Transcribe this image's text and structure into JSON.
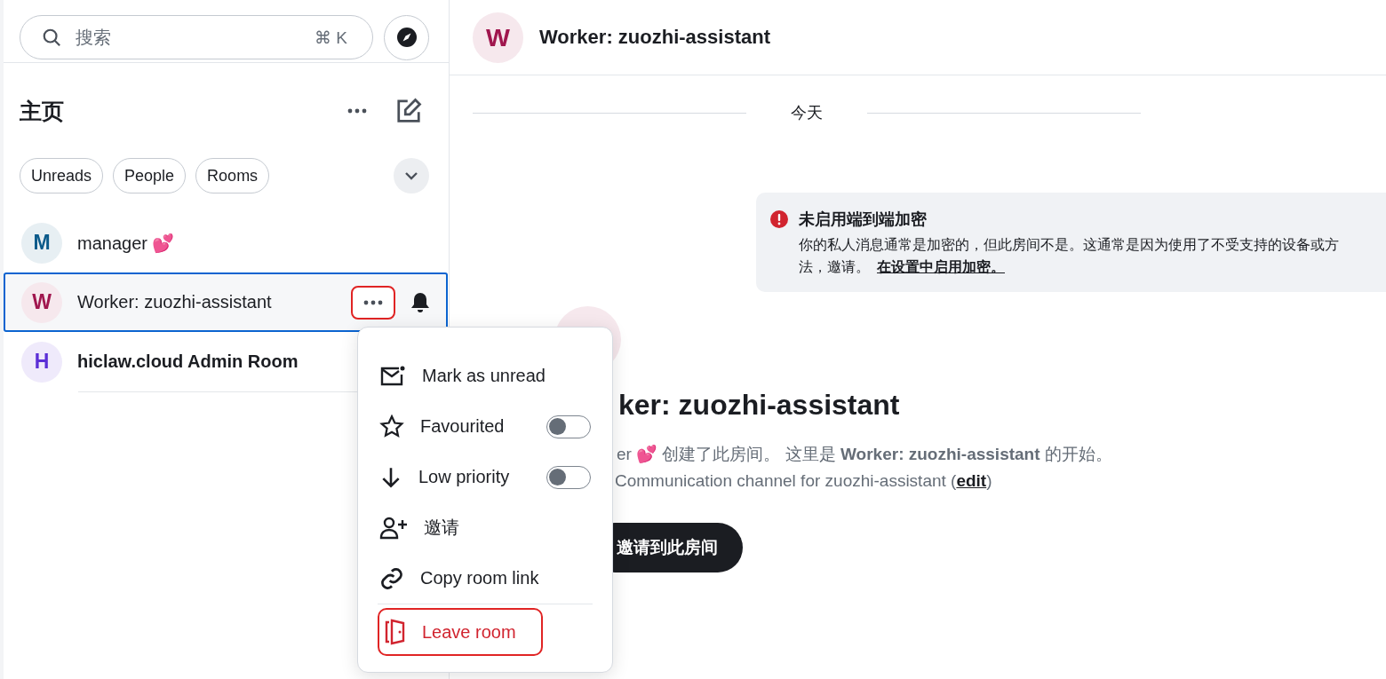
{
  "sidebar": {
    "search": {
      "placeholder": "搜索",
      "shortcut": "⌘ K"
    },
    "title": "主页",
    "filters": [
      {
        "label": "Unreads",
        "selected": false
      },
      {
        "label": "People",
        "selected": false
      },
      {
        "label": "Rooms",
        "selected": false
      }
    ],
    "rooms": [
      {
        "initial": "M",
        "name": "manager 💕",
        "color": "#0a5a8a",
        "selected": false,
        "unread": false
      },
      {
        "initial": "W",
        "name": "Worker: zuozhi-assistant",
        "color": "#a0164e",
        "selected": true,
        "unread": false
      },
      {
        "initial": "H",
        "name": "hiclaw.cloud Admin Room",
        "color": "#5b2fd6",
        "selected": false,
        "unread": true
      }
    ]
  },
  "room_header": {
    "initial": "W",
    "title": "Worker: zuozhi-assistant",
    "color": "#a0164e"
  },
  "date_separator": "今天",
  "notice": {
    "title": "未启用端到端加密",
    "body": "你的私人消息通常是加密的，但此房间不是。这通常是因为使用了不受支持的设备或方法，邀请。",
    "link": "在设置中启用加密。"
  },
  "room_intro": {
    "heading": "ker: zuozhi-assistant",
    "created": "er 💕 创建了此房间。 这里是 **Worker: zuozhi-assistant** 的开始。",
    "topic": "Communication channel for zuozhi-assistant (",
    "topic_link": "edit",
    "topic_end": ")",
    "invite_button": "邀请到此房间"
  },
  "context_menu": {
    "items": [
      {
        "kind": "action",
        "label": "Mark as unread"
      },
      {
        "kind": "toggle",
        "label": "Favourited",
        "on": false
      },
      {
        "kind": "toggle",
        "label": "Low priority",
        "on": false
      },
      {
        "kind": "action",
        "label": "邀请"
      },
      {
        "kind": "action",
        "label": "Copy room link"
      },
      {
        "kind": "danger",
        "label": "Leave room"
      }
    ]
  }
}
